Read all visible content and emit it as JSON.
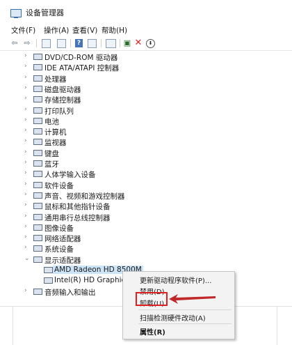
{
  "window": {
    "title": "设备管理器"
  },
  "menu": [
    "文件(F)",
    "操作(A)",
    "查看(V)",
    "帮助(H)"
  ],
  "toolbar_icons": [
    "back-arrow-icon",
    "forward-arrow-icon",
    "properties-icon",
    "view-icon",
    "help-icon",
    "device-icon",
    "monitor-icon",
    "update-driver-icon",
    "remove-icon",
    "download-icon"
  ],
  "tree": {
    "categories": [
      "DVD/CD-ROM 驱动器",
      "IDE ATA/ATAPI 控制器",
      "处理器",
      "磁盘驱动器",
      "存储控制器",
      "打印队列",
      "电池",
      "计算机",
      "监视器",
      "键盘",
      "蓝牙",
      "人体学输入设备",
      "软件设备",
      "声音、视频和游戏控制器",
      "鼠标和其他指针设备",
      "通用串行总线控制器",
      "图像设备",
      "网络适配器",
      "系统设备",
      "显示适配器"
    ],
    "display_children": [
      "AMD Radeon HD 8500M",
      "Intel(R) HD Graphics"
    ],
    "after": "音频输入和输出"
  },
  "context_menu": {
    "items": [
      "更新驱动程序软件(P)...",
      "禁用(D)",
      "卸载(U)",
      "扫描检测硬件改动(A)",
      "属性(R)"
    ]
  },
  "colors": {
    "highlight": "#e02020",
    "selection": "#cce4f7"
  }
}
